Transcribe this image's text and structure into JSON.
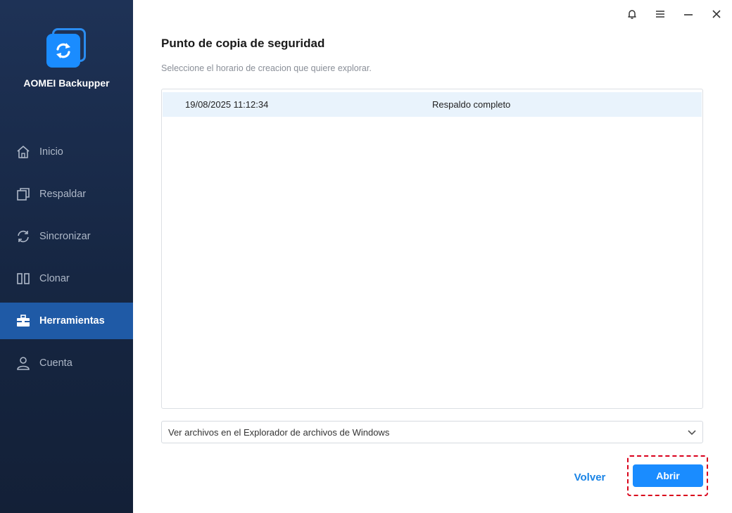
{
  "app": {
    "name": "AOMEI Backupper",
    "logo_icon": "sync-arrows-icon"
  },
  "sidebar": {
    "items": [
      {
        "label": "Inicio",
        "icon": "home-icon",
        "active": false
      },
      {
        "label": "Respaldar",
        "icon": "copy-icon",
        "active": false
      },
      {
        "label": "Sincronizar",
        "icon": "sync-icon",
        "active": false
      },
      {
        "label": "Clonar",
        "icon": "clone-icon",
        "active": false
      },
      {
        "label": "Herramientas",
        "icon": "toolbox-icon",
        "active": true
      },
      {
        "label": "Cuenta",
        "icon": "user-icon",
        "active": false
      }
    ]
  },
  "window_controls": [
    "bell-icon",
    "menu-icon",
    "minimize-icon",
    "close-icon"
  ],
  "main": {
    "title": "Punto de copia de seguridad",
    "subtitle": "Seleccione el horario de creacion que quiere explorar.",
    "backup_points": [
      {
        "date": "19/08/2025 11:12:34",
        "type": "Respaldo completo",
        "selected": true
      }
    ],
    "view_mode": {
      "selected": "Ver archivos en el Explorador de archivos de Windows"
    },
    "buttons": {
      "back": "Volver",
      "open": "Abrir"
    }
  },
  "colors": {
    "sidebar_bg": "#1a2c4c",
    "active_item": "#1f5aa6",
    "accent": "#1a8cff",
    "highlight_border": "#d9001b",
    "selected_row": "#e9f3fc"
  }
}
